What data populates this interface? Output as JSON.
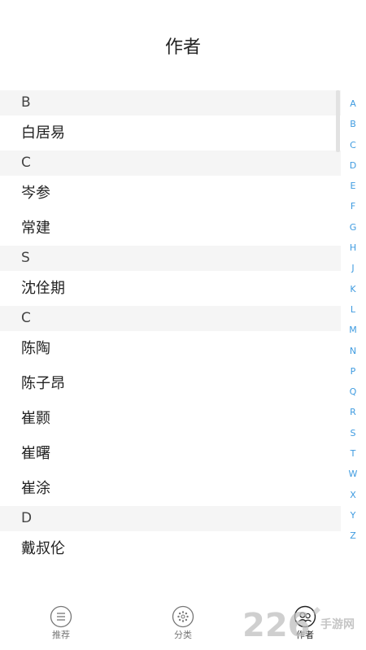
{
  "header": {
    "title": "作者"
  },
  "sections": [
    {
      "letter": "B",
      "authors": [
        "白居易"
      ]
    },
    {
      "letter": "C",
      "authors": [
        "岑参",
        "常建"
      ]
    },
    {
      "letter": "S",
      "authors": [
        "沈佺期"
      ]
    },
    {
      "letter": "C",
      "authors": [
        "陈陶",
        "陈子昂",
        "崔颢",
        "崔曙",
        "崔涂"
      ]
    },
    {
      "letter": "D",
      "authors": [
        "戴叔伦"
      ]
    }
  ],
  "alpha_index": [
    "A",
    "B",
    "C",
    "D",
    "E",
    "F",
    "G",
    "H",
    "J",
    "K",
    "L",
    "M",
    "N",
    "P",
    "Q",
    "R",
    "S",
    "T",
    "W",
    "X",
    "Y",
    "Z"
  ],
  "tabbar": {
    "tabs": [
      {
        "label": "推荐",
        "icon": "list-icon"
      },
      {
        "label": "分类",
        "icon": "category-icon"
      },
      {
        "label": "作者",
        "icon": "author-icon",
        "active": true
      }
    ]
  },
  "watermark": {
    "text": "2265手游网"
  },
  "colors": {
    "index_accent": "#3e9be0",
    "section_bg": "#f5f5f5",
    "watermark": "#bfbfbf"
  }
}
